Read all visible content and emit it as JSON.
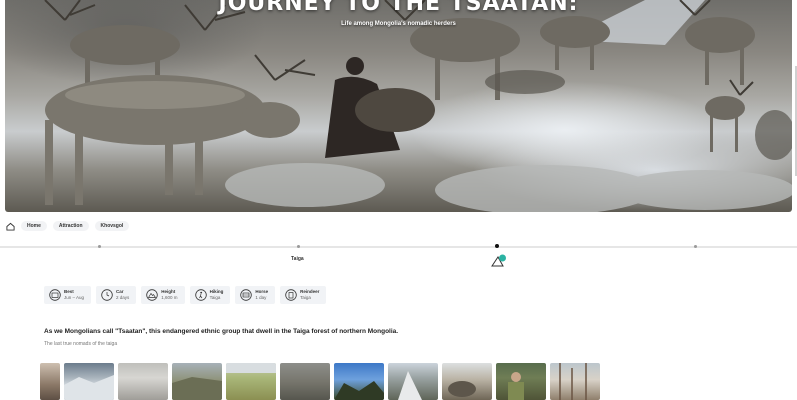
{
  "hero": {
    "title": "JOURNEY TO THE TSAATAN:",
    "subtitle": "Life among Mongolia's nomadic herders"
  },
  "breadcrumb": {
    "home_icon": "home-icon",
    "items": [
      "Home",
      "Attraction",
      "Khovsgol"
    ]
  },
  "timeline": {
    "label": "Taiga",
    "active_index": 2,
    "marker_icon": "mountain-pin-icon",
    "marker_color": "#2bb3a3"
  },
  "info": {
    "items": [
      {
        "icon": "calendar-icon",
        "label": "Best",
        "value": "Jun – Aug"
      },
      {
        "icon": "clock-icon",
        "label": "Car",
        "value": "2 days"
      },
      {
        "icon": "mountain-icon",
        "label": "Height",
        "value": "1,600 m"
      },
      {
        "icon": "hiking-icon",
        "label": "Hiking",
        "value": "Taiga"
      },
      {
        "icon": "horse-icon",
        "label": "Horse",
        "value": "1 day"
      },
      {
        "icon": "reindeer-icon",
        "label": "Reindeer",
        "value": "Taiga"
      }
    ]
  },
  "description": {
    "main": "As we Mongolians call \"Tsaatan\", this endangered ethnic group that dwell in the Taiga forest of northern Mongolia.",
    "sub": "The last true nomads of the taiga"
  },
  "gallery": {
    "count": 11
  }
}
